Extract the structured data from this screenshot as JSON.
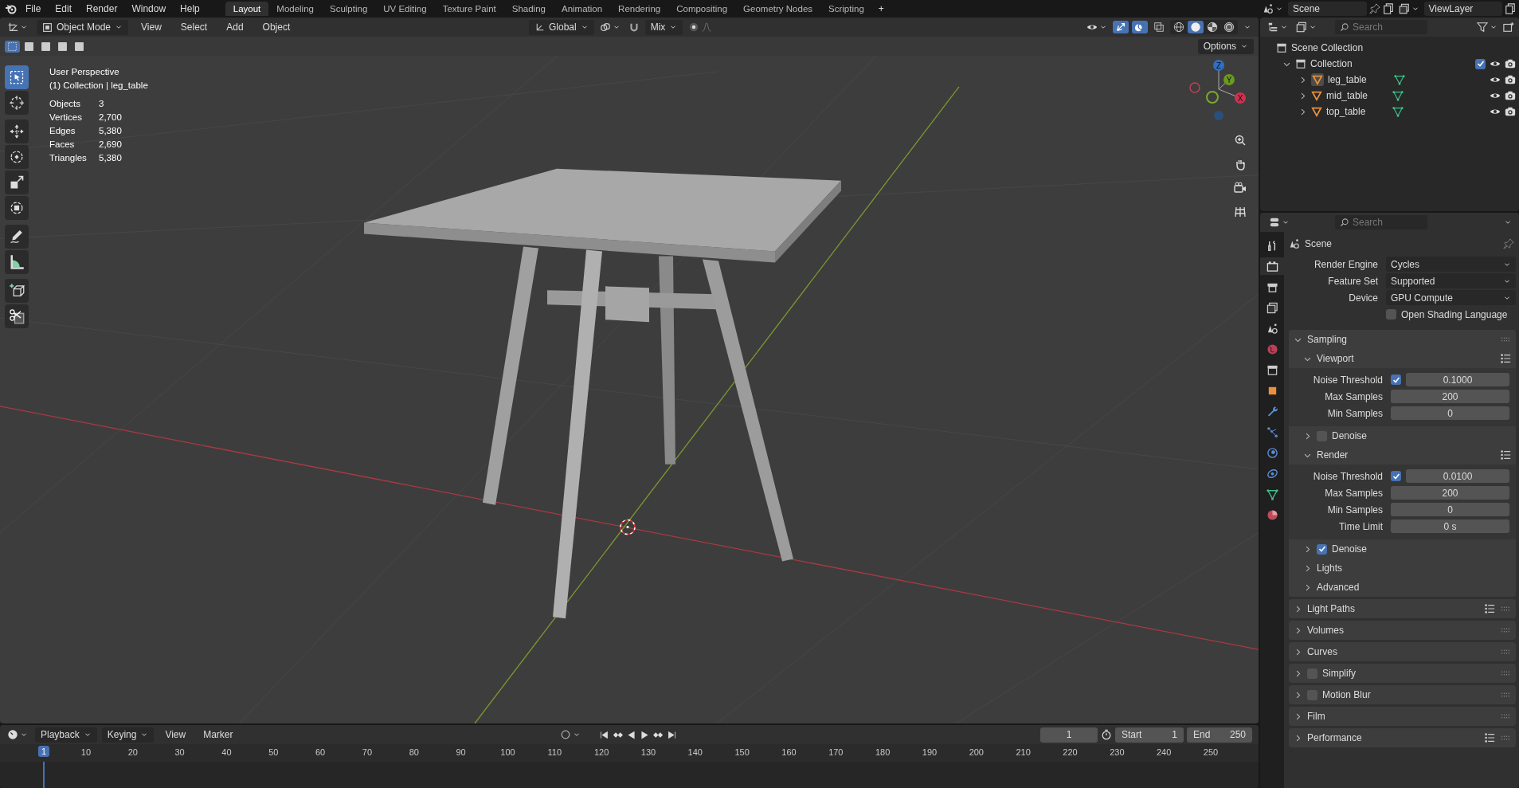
{
  "topbar": {
    "menus": [
      "File",
      "Edit",
      "Render",
      "Window",
      "Help"
    ],
    "workspaces": [
      {
        "label": "Layout",
        "selected": true
      },
      {
        "label": "Modeling",
        "selected": false
      },
      {
        "label": "Sculpting",
        "selected": false
      },
      {
        "label": "UV Editing",
        "selected": false
      },
      {
        "label": "Texture Paint",
        "selected": false
      },
      {
        "label": "Shading",
        "selected": false
      },
      {
        "label": "Animation",
        "selected": false
      },
      {
        "label": "Rendering",
        "selected": false
      },
      {
        "label": "Compositing",
        "selected": false
      },
      {
        "label": "Geometry Nodes",
        "selected": false
      },
      {
        "label": "Scripting",
        "selected": false
      }
    ],
    "add_workspace": "+",
    "scene": "Scene",
    "view_layer": "ViewLayer"
  },
  "viewport": {
    "mode": "Object Mode",
    "menus": [
      "View",
      "Select",
      "Add",
      "Object"
    ],
    "orientation": "Global",
    "snap_target": "Mix",
    "toggles": [
      {
        "kind": "gizmo",
        "on": true
      },
      {
        "kind": "overlay",
        "on": true
      },
      {
        "kind": "xray",
        "on": false
      }
    ],
    "shading_modes": [
      {
        "kind": "wireframe",
        "selected": false
      },
      {
        "kind": "solid",
        "selected": true
      },
      {
        "kind": "material",
        "selected": false
      },
      {
        "kind": "rendered",
        "selected": false
      }
    ],
    "select_modes": [
      {
        "selected": true
      },
      {
        "selected": false
      },
      {
        "selected": false
      },
      {
        "selected": false
      },
      {
        "selected": false
      }
    ],
    "options": "Options",
    "view_name": "User Perspective",
    "context": "(1) Collection | leg_table",
    "stats": [
      {
        "label": "Objects",
        "value": "3"
      },
      {
        "label": "Vertices",
        "value": "2,700"
      },
      {
        "label": "Edges",
        "value": "5,380"
      },
      {
        "label": "Faces",
        "value": "2,690"
      },
      {
        "label": "Triangles",
        "value": "5,380"
      }
    ],
    "gizmo_axes": [
      "Z",
      "Y",
      "X"
    ],
    "tool_groups": [
      [
        {
          "kind": "select",
          "selected": true
        },
        {
          "kind": "cursor",
          "selected": false
        }
      ],
      [
        {
          "kind": "move",
          "selected": false
        },
        {
          "kind": "rotate",
          "selected": false
        },
        {
          "kind": "scale",
          "selected": false
        },
        {
          "kind": "transform",
          "selected": false
        }
      ],
      [
        {
          "kind": "annotate",
          "selected": false
        },
        {
          "kind": "measure",
          "selected": false
        }
      ],
      [
        {
          "kind": "add_cube",
          "selected": false
        },
        {
          "kind": "scissors",
          "selected": false
        }
      ]
    ]
  },
  "outliner": {
    "search_placeholder": "Search",
    "root": "Scene Collection",
    "collection": {
      "label": "Collection",
      "expanded": true,
      "checked": true,
      "children": [
        {
          "label": "leg_table",
          "selected": true,
          "expanded": false
        },
        {
          "label": "mid_table",
          "selected": false,
          "expanded": false
        },
        {
          "label": "top_table",
          "selected": false,
          "expanded": false
        }
      ]
    }
  },
  "properties": {
    "tabs": [
      {
        "kind": "tool",
        "selected": false
      },
      {
        "kind": "render",
        "selected": true
      },
      {
        "kind": "output",
        "selected": false
      },
      {
        "kind": "view_layer",
        "selected": false
      },
      {
        "kind": "scene",
        "selected": false
      },
      {
        "kind": "world",
        "selected": false
      },
      {
        "kind": "collection",
        "selected": false
      },
      {
        "kind": "object",
        "selected": false
      },
      {
        "kind": "modifier",
        "selected": false
      },
      {
        "kind": "particles",
        "selected": false
      },
      {
        "kind": "physics",
        "selected": false
      },
      {
        "kind": "constraints",
        "selected": false
      },
      {
        "kind": "data",
        "selected": false
      },
      {
        "kind": "material",
        "selected": false
      }
    ],
    "search_placeholder": "Search",
    "context": "Scene",
    "fields": [
      {
        "kind": "dropdown",
        "label": "Render Engine",
        "value": "Cycles"
      },
      {
        "kind": "dropdown",
        "label": "Feature Set",
        "value": "Supported"
      },
      {
        "kind": "dropdown",
        "label": "Device",
        "value": "GPU Compute"
      },
      {
        "kind": "checkbox",
        "label": "Open Shading Language",
        "checked": false
      }
    ],
    "sampling": {
      "label": "Sampling",
      "expanded": true,
      "subpanels": [
        {
          "kind": "panel",
          "label": "Viewport",
          "expanded": true,
          "presets": true,
          "rows": [
            {
              "kind": "toggle_number",
              "label": "Noise Threshold",
              "checked": true,
              "value": "0.1000"
            },
            {
              "kind": "number",
              "label": "Max Samples",
              "value": "200"
            },
            {
              "kind": "number",
              "label": "Min Samples",
              "value": "0"
            }
          ]
        },
        {
          "kind": "toggle_panel",
          "label": "Denoise",
          "expanded": false,
          "checked": false
        },
        {
          "kind": "panel",
          "label": "Render",
          "expanded": true,
          "presets": true,
          "rows": [
            {
              "kind": "toggle_number",
              "label": "Noise Threshold",
              "checked": true,
              "value": "0.0100"
            },
            {
              "kind": "number",
              "label": "Max Samples",
              "value": "200"
            },
            {
              "kind": "number",
              "label": "Min Samples",
              "value": "0"
            },
            {
              "kind": "number",
              "label": "Time Limit",
              "value": "0 s"
            }
          ]
        },
        {
          "kind": "toggle_panel",
          "label": "Denoise",
          "expanded": false,
          "checked": true
        },
        {
          "kind": "panel",
          "label": "Lights",
          "expanded": false
        },
        {
          "kind": "panel",
          "label": "Advanced",
          "expanded": false
        }
      ]
    },
    "panels": [
      {
        "kind": "panel",
        "label": "Light Paths",
        "expanded": false,
        "presets": true
      },
      {
        "kind": "panel",
        "label": "Volumes",
        "expanded": false
      },
      {
        "kind": "panel",
        "label": "Curves",
        "expanded": false
      },
      {
        "kind": "toggle_panel",
        "label": "Simplify",
        "expanded": false,
        "checked": false
      },
      {
        "kind": "toggle_panel",
        "label": "Motion Blur",
        "expanded": false,
        "checked": false
      },
      {
        "kind": "panel",
        "label": "Film",
        "expanded": false
      },
      {
        "kind": "panel",
        "label": "Performance",
        "expanded": false,
        "presets": true
      }
    ]
  },
  "timeline": {
    "menus": [
      {
        "kind": "dropdown",
        "label": "Playback"
      },
      {
        "kind": "dropdown",
        "label": "Keying"
      },
      {
        "kind": "menu",
        "label": "View"
      },
      {
        "kind": "menu",
        "label": "Marker"
      }
    ],
    "current_frame": "1",
    "start_label": "Start",
    "start": "1",
    "end_label": "End",
    "end": "250",
    "playhead": "1",
    "ruler": [
      "10",
      "20",
      "30",
      "40",
      "50",
      "60",
      "70",
      "80",
      "90",
      "100",
      "110",
      "120",
      "130",
      "140",
      "150",
      "160",
      "170",
      "180",
      "190",
      "200",
      "210",
      "220",
      "230",
      "240",
      "250"
    ]
  }
}
